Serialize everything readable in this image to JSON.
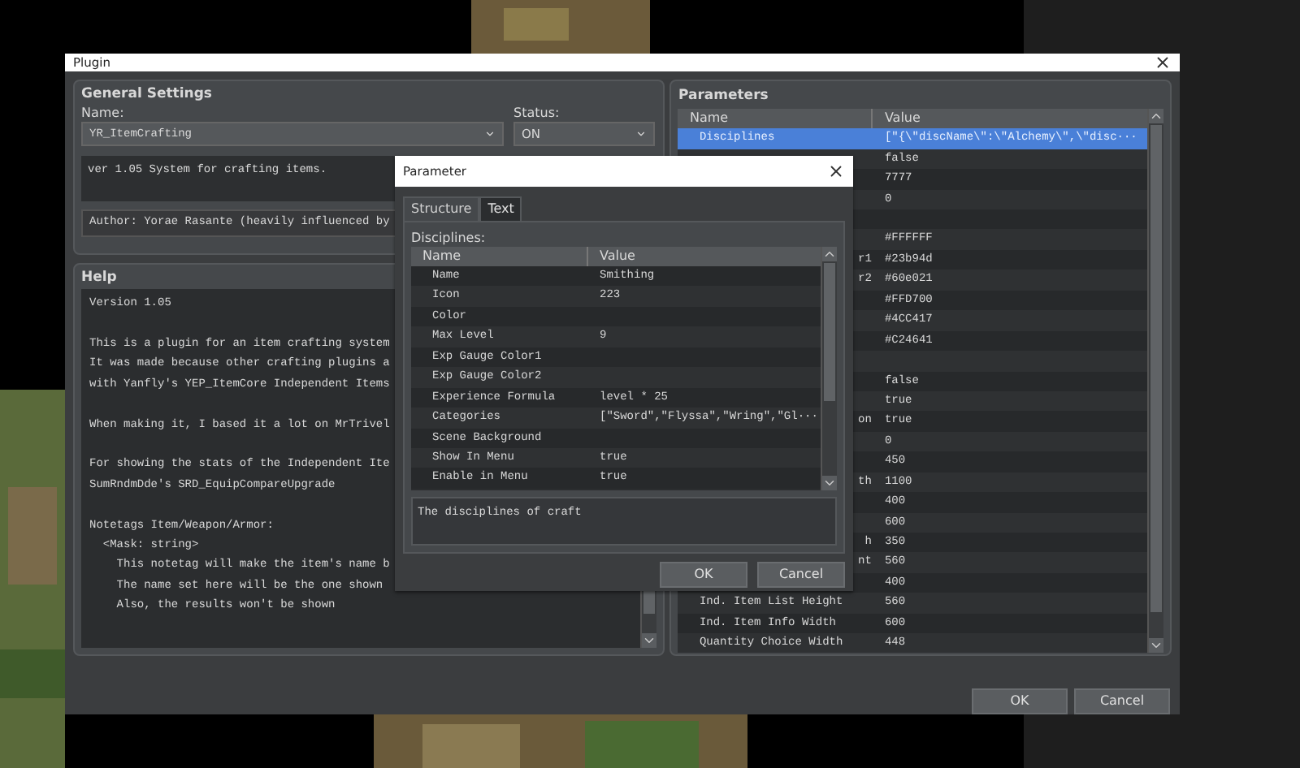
{
  "window": {
    "title": "Plugin"
  },
  "general_settings": {
    "title": "General Settings",
    "name_label": "Name:",
    "name_value": "YR_ItemCrafting",
    "status_label": "Status:",
    "status_value": "ON",
    "description": "ver 1.05 System for crafting items.",
    "author": "Author: Yorae Rasante (heavily influenced by"
  },
  "help": {
    "title": "Help",
    "paragraphs": [
      [
        "Version 1.05"
      ],
      [
        "This is a plugin for an item crafting system",
        "It was made because other crafting plugins a",
        "with Yanfly's YEP_ItemCore Independent Items"
      ],
      [
        "When making it, I based it a lot on MrTrivel"
      ],
      [
        "For showing the stats of the Independent Ite",
        "SumRndmDde's SRD_EquipCompareUpgrade"
      ],
      [
        "Notetags Item/Weapon/Armor:",
        "  <Mask: string>",
        "    This notetag will make the item's name b",
        "    The name set here will be the one shown",
        "    Also, the results won't be shown"
      ]
    ]
  },
  "parameters": {
    "title": "Parameters",
    "columns": [
      "Name",
      "Value"
    ],
    "rows": [
      {
        "name": "Disciplines",
        "value": "[\"{\\\"discName\\\":\\\"Alchemy\\\",\\\"disc···",
        "selected": true
      },
      {
        "value": "false",
        "selected": false
      },
      {
        "value": "7777",
        "selected": false
      },
      {
        "value": "0",
        "selected": false
      },
      {
        "selected": false
      },
      {
        "value": "#FFFFFF",
        "selected": false
      },
      {
        "name": "r1",
        "cut": true,
        "value": "#23b94d",
        "selected": false
      },
      {
        "name": "r2",
        "cut": true,
        "value": "#60e021",
        "selected": false
      },
      {
        "value": "#FFD700",
        "selected": false
      },
      {
        "value": "#4CC417",
        "selected": false
      },
      {
        "value": "#C24641",
        "selected": false
      },
      {
        "selected": false
      },
      {
        "value": "false",
        "selected": false
      },
      {
        "value": "true",
        "selected": false
      },
      {
        "name": "on",
        "cut": true,
        "value": "true",
        "selected": false
      },
      {
        "value": "0",
        "selected": false
      },
      {
        "value": "450",
        "selected": false
      },
      {
        "name": "th",
        "cut": true,
        "value": "1100",
        "selected": false
      },
      {
        "value": "400",
        "selected": false
      },
      {
        "value": "600",
        "selected": false
      },
      {
        "name": "h",
        "cut": true,
        "value": "350",
        "selected": false
      },
      {
        "name": "nt",
        "cut": true,
        "value": "560",
        "selected": false
      },
      {
        "value": "400",
        "selected": false
      },
      {
        "name": "Ind. Item List Height",
        "value": "560",
        "selected": false
      },
      {
        "name": "Ind. Item Info Width",
        "value": "600",
        "selected": false
      },
      {
        "name": "Quantity Choice Width",
        "value": "448",
        "selected": false
      }
    ]
  },
  "buttons": [
    "OK",
    "Cancel"
  ],
  "parameter_dialog": {
    "title": "Parameter",
    "tabs": [
      {
        "label": "Structure",
        "selected": true
      },
      {
        "label": "Text",
        "selected": false
      }
    ],
    "label": "Disciplines:",
    "columns": [
      "Name",
      "Value"
    ],
    "rows": [
      {
        "name": "Name",
        "value": "Smithing"
      },
      {
        "name": "Icon",
        "value": "223"
      },
      {
        "name": "Color"
      },
      {
        "name": "Max Level",
        "value": "9"
      },
      {
        "name": "Exp Gauge Color1"
      },
      {
        "name": "Exp Gauge Color2"
      },
      {
        "name": "Experience Formula",
        "value": "level * 25"
      },
      {
        "name": "Categories",
        "value": "[\"Sword\",\"Flyssa\",\"Wring\",\"Gl···"
      },
      {
        "name": "Scene Background"
      },
      {
        "name": "Show In Menu",
        "value": "true"
      },
      {
        "name": "Enable in Menu",
        "value": "true"
      }
    ],
    "description": "The disciplines of craft",
    "buttons": [
      "OK",
      "Cancel"
    ]
  }
}
